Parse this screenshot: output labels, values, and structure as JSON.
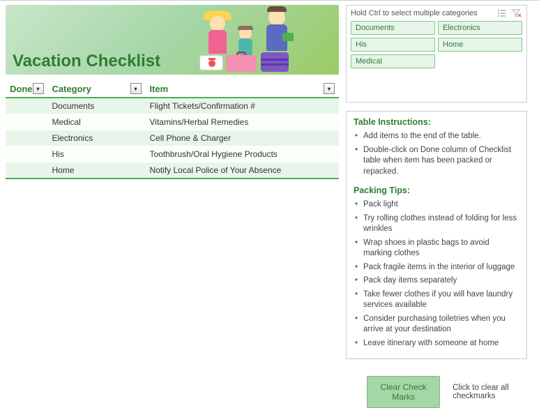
{
  "hero": {
    "title": "Vacation Checklist"
  },
  "table": {
    "headers": {
      "done": "Done",
      "category": "Category",
      "item": "Item"
    },
    "rows": [
      {
        "done": "",
        "category": "Documents",
        "item": "Flight Tickets/Confirmation #"
      },
      {
        "done": "",
        "category": "Medical",
        "item": "Vitamins/Herbal Remedies"
      },
      {
        "done": "",
        "category": "Electronics",
        "item": "Cell Phone & Charger"
      },
      {
        "done": "",
        "category": "His",
        "item": "Toothbrush/Oral Hygiene Products"
      },
      {
        "done": "",
        "category": "Home",
        "item": "Notify Local Police of Your Absence"
      }
    ]
  },
  "slicer": {
    "hint": "Hold Ctrl to select multiple categories",
    "items": [
      "Documents",
      "Electronics",
      "His",
      "Home",
      "Medical"
    ]
  },
  "instructions": {
    "table_title": "Table Instructions:",
    "table_items": [
      "Add items to the end of the table.",
      "Double-click on Done column of Checklist table when item has been packed or repacked."
    ],
    "tips_title": "Packing Tips:",
    "tips_items": [
      "Pack light",
      "Try rolling clothes instead of folding for less wrinkles",
      "Wrap shoes in plastic bags to avoid marking clothes",
      "Pack fragile items in the interior of luggage",
      "Pack day items separately",
      "Take fewer clothes if you will have laundry services available",
      "Consider purchasing toiletries when you arrive at your destination",
      "Leave itinerary with someone at home"
    ]
  },
  "actions": {
    "clear_button": "Clear Check Marks",
    "clear_hint": "Click to clear all checkmarks"
  }
}
